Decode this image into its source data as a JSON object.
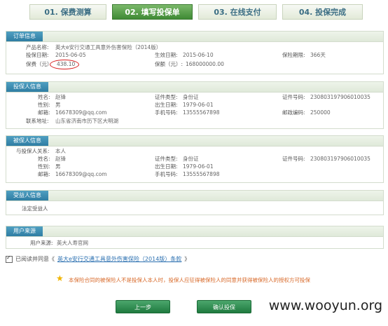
{
  "steps": [
    {
      "label": "01. 保费测算",
      "active": false
    },
    {
      "label": "02. 填写投保单",
      "active": true
    },
    {
      "label": "03. 在线支付",
      "active": false
    },
    {
      "label": "04. 投保完成",
      "active": false
    }
  ],
  "order": {
    "title": "订单信息",
    "product_label": "产品名称:",
    "product_value": "英大e安行交通工具意外伤害保险（2014版）",
    "start_label": "投保日期:",
    "start_value": "2015-06-05",
    "effective_label": "生效日期:",
    "effective_value": "2015-06-10",
    "period_label": "保险期限:",
    "period_value": "366天",
    "premium_label": "保费（元）",
    "premium_value": "438.10",
    "coverage_label": "保额（元）:",
    "coverage_value": "168000000.00"
  },
  "applicant": {
    "title": "投保人信息",
    "name_label": "姓名:",
    "name_value": "赵锋",
    "idtype_label": "证件类型:",
    "idtype_value": "身份证",
    "idno_label": "证件号码:",
    "idno_value": "230803197906010035",
    "gender_label": "性别:",
    "gender_value": "男",
    "birth_label": "出生日期:",
    "birth_value": "1979-06-01",
    "email_label": "邮箱:",
    "email_value": "16678309@qq.com",
    "phone_label": "手机号码:",
    "phone_value": "13555567898",
    "zip_label": "邮政编码:",
    "zip_value": "250000",
    "address_label": "联系地址:",
    "address_value": "山东省济南市历下区大明湖"
  },
  "insured": {
    "title": "被保人信息",
    "relation_label": "与投保人关系:",
    "relation_value": "本人",
    "name_label": "姓名:",
    "name_value": "赵锋",
    "idtype_label": "证件类型:",
    "idtype_value": "身份证",
    "idno_label": "证件号码:",
    "idno_value": "230803197906010035",
    "gender_label": "性别:",
    "gender_value": "男",
    "birth_label": "出生日期:",
    "birth_value": "1979-06-01",
    "email_label": "邮箱:",
    "email_value": "16678309@qq.com",
    "phone_label": "手机号码:",
    "phone_value": "13555567898"
  },
  "beneficiary": {
    "title": "受益人信息",
    "value": "法定受益人"
  },
  "source": {
    "title": "用户来源",
    "label": "用户来源:",
    "value": "英大人寿官网"
  },
  "agree": {
    "prefix": "已阅读并同意《",
    "link": "英大e安行交通工具意外伤害保险（2014版）条款",
    "suffix": "》"
  },
  "notice": "本保险合同的被保险人不是投保人本人时，投保人应征得被保险人的同意并获得被保险人的授权方可投保",
  "buttons": {
    "prev": "上一步",
    "confirm": "确认投保"
  },
  "watermark": "www.wooyun.org",
  "colors": {
    "accent": "#2f7da3",
    "active_step": "#3f8a34",
    "highlight": "#d81e1e",
    "notice": "#d86a2a"
  }
}
